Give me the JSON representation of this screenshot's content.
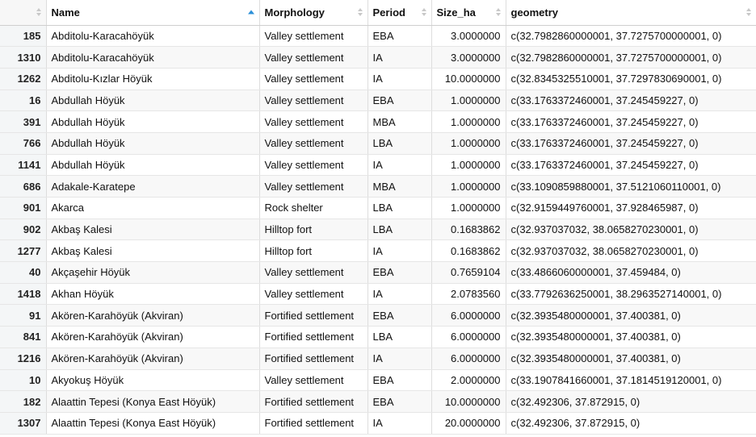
{
  "columns": [
    {
      "key": "rownum",
      "label": "",
      "sorted": false
    },
    {
      "key": "name",
      "label": "Name",
      "sorted": true,
      "sort_dir": "asc"
    },
    {
      "key": "morphology",
      "label": "Morphology",
      "sorted": false
    },
    {
      "key": "period",
      "label": "Period",
      "sorted": false
    },
    {
      "key": "size",
      "label": "Size_ha",
      "sorted": false
    },
    {
      "key": "geometry",
      "label": "geometry",
      "sorted": false
    }
  ],
  "rows": [
    {
      "rownum": "185",
      "name": "Abditolu-Karacahöyük",
      "morphology": "Valley settlement",
      "period": "EBA",
      "size": "3.0000000",
      "geometry": "c(32.7982860000001, 37.7275700000001, 0)"
    },
    {
      "rownum": "1310",
      "name": "Abditolu-Karacahöyük",
      "morphology": "Valley settlement",
      "period": "IA",
      "size": "3.0000000",
      "geometry": "c(32.7982860000001, 37.7275700000001, 0)"
    },
    {
      "rownum": "1262",
      "name": "Abditolu-Kızlar Höyük",
      "morphology": "Valley settlement",
      "period": "IA",
      "size": "10.0000000",
      "geometry": "c(32.8345325510001, 37.7297830690001, 0)"
    },
    {
      "rownum": "16",
      "name": "Abdullah Höyük",
      "morphology": "Valley settlement",
      "period": "EBA",
      "size": "1.0000000",
      "geometry": "c(33.1763372460001, 37.245459227, 0)"
    },
    {
      "rownum": "391",
      "name": "Abdullah Höyük",
      "morphology": "Valley settlement",
      "period": "MBA",
      "size": "1.0000000",
      "geometry": "c(33.1763372460001, 37.245459227, 0)"
    },
    {
      "rownum": "766",
      "name": "Abdullah Höyük",
      "morphology": "Valley settlement",
      "period": "LBA",
      "size": "1.0000000",
      "geometry": "c(33.1763372460001, 37.245459227, 0)"
    },
    {
      "rownum": "1141",
      "name": "Abdullah Höyük",
      "morphology": "Valley settlement",
      "period": "IA",
      "size": "1.0000000",
      "geometry": "c(33.1763372460001, 37.245459227, 0)"
    },
    {
      "rownum": "686",
      "name": "Adakale-Karatepe",
      "morphology": "Valley settlement",
      "period": "MBA",
      "size": "1.0000000",
      "geometry": "c(33.1090859880001, 37.5121060110001, 0)"
    },
    {
      "rownum": "901",
      "name": "Akarca",
      "morphology": "Rock shelter",
      "period": "LBA",
      "size": "1.0000000",
      "geometry": "c(32.9159449760001, 37.928465987, 0)"
    },
    {
      "rownum": "902",
      "name": "Akbaş Kalesi",
      "morphology": "Hilltop fort",
      "period": "LBA",
      "size": "0.1683862",
      "geometry": "c(32.937037032, 38.0658270230001, 0)"
    },
    {
      "rownum": "1277",
      "name": "Akbaş Kalesi",
      "morphology": "Hilltop fort",
      "period": "IA",
      "size": "0.1683862",
      "geometry": "c(32.937037032, 38.0658270230001, 0)"
    },
    {
      "rownum": "40",
      "name": "Akçaşehir Höyük",
      "morphology": "Valley settlement",
      "period": "EBA",
      "size": "0.7659104",
      "geometry": "c(33.4866060000001, 37.459484, 0)"
    },
    {
      "rownum": "1418",
      "name": "Akhan Höyük",
      "morphology": "Valley settlement",
      "period": "IA",
      "size": "2.0783560",
      "geometry": "c(33.7792636250001, 38.2963527140001, 0)"
    },
    {
      "rownum": "91",
      "name": "Akören-Karahöyük (Akviran)",
      "morphology": "Fortified settlement",
      "period": "EBA",
      "size": "6.0000000",
      "geometry": "c(32.3935480000001, 37.400381, 0)"
    },
    {
      "rownum": "841",
      "name": "Akören-Karahöyük (Akviran)",
      "morphology": "Fortified settlement",
      "period": "LBA",
      "size": "6.0000000",
      "geometry": "c(32.3935480000001, 37.400381, 0)"
    },
    {
      "rownum": "1216",
      "name": "Akören-Karahöyük (Akviran)",
      "morphology": "Fortified settlement",
      "period": "IA",
      "size": "6.0000000",
      "geometry": "c(32.3935480000001, 37.400381, 0)"
    },
    {
      "rownum": "10",
      "name": "Akyokuş Höyük",
      "morphology": "Valley settlement",
      "period": "EBA",
      "size": "2.0000000",
      "geometry": "c(33.1907841660001, 37.1814519120001, 0)"
    },
    {
      "rownum": "182",
      "name": "Alaattin Tepesi (Konya East Höyük)",
      "morphology": "Fortified settlement",
      "period": "EBA",
      "size": "10.0000000",
      "geometry": "c(32.492306, 37.872915, 0)"
    },
    {
      "rownum": "1307",
      "name": "Alaattin Tepesi (Konya East Höyük)",
      "morphology": "Fortified settlement",
      "period": "IA",
      "size": "20.0000000",
      "geometry": "c(32.492306, 37.872915, 0)"
    }
  ],
  "colors": {
    "sort_active": "#2a8fd8",
    "sort_inactive": "#c8c8c8",
    "rownum_bg": "#f4f6f7"
  }
}
